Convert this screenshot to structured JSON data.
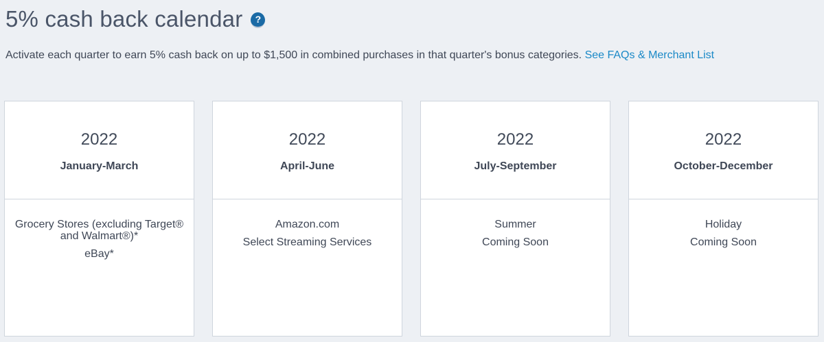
{
  "header": {
    "title": "5% cash back calendar",
    "help_icon_glyph": "?",
    "help_icon": "question-circle-icon"
  },
  "intro": {
    "text": "Activate each quarter to earn 5% cash back on up to $1,500 in combined purchases in that quarter's bonus categories. ",
    "link_label": "See FAQs & Merchant List"
  },
  "quarters": [
    {
      "year": "2022",
      "period": "January-March",
      "categories": [
        "Grocery Stores (excluding Target® and Walmart®)*",
        "eBay*"
      ]
    },
    {
      "year": "2022",
      "period": "April-June",
      "categories": [
        "Amazon.com",
        "Select Streaming Services"
      ]
    },
    {
      "year": "2022",
      "period": "July-September",
      "categories": [
        "Summer",
        "Coming Soon"
      ]
    },
    {
      "year": "2022",
      "period": "October-December",
      "categories": [
        "Holiday",
        "Coming Soon"
      ]
    }
  ],
  "colors": {
    "background": "#edf0f4",
    "link": "#1a89c7",
    "help_icon": "#1a6aa5",
    "card_border": "#cfd5dd"
  }
}
